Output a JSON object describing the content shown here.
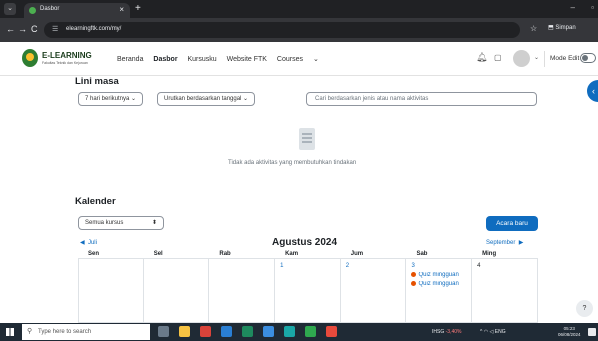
{
  "browser": {
    "tab_title": "Dasbor",
    "url": "elearningftk.com/my/",
    "saved_label": "Simpan",
    "new_tab": "+"
  },
  "navbar": {
    "brand": "E-LEARNING",
    "brand_sub": "Fakultas Teknik dan Kejuruan",
    "menu": {
      "home": "Beranda",
      "dashboard": "Dasbor",
      "my_courses": "Kursusku",
      "site": "Website FTK",
      "courses": "Courses"
    },
    "mode_edit": "Mode Edit"
  },
  "timeline": {
    "title": "Lini masa",
    "filter_days": "7 hari berikutnya",
    "sort": "Urutkan berdasarkan tanggal",
    "search_placeholder": "Cari berdasarkan jenis atau nama aktivitas",
    "empty": "Tidak ada aktivitas yang membutuhkan tindakan"
  },
  "calendar": {
    "title": "Kalender",
    "course_filter": "Semua kursus",
    "new_event": "Acara baru",
    "prev": "Juli",
    "month": "Agustus 2024",
    "next": "September",
    "days": [
      "Sen",
      "Sel",
      "Rab",
      "Kam",
      "Jum",
      "Sab",
      "Ming"
    ],
    "dates": [
      "",
      "",
      "",
      "1",
      "2",
      "3",
      "4"
    ],
    "events": {
      "sat_1": "Quiz mingguan",
      "sat_2": "Quiz mingguan"
    }
  },
  "taskbar": {
    "search": "Type here to search",
    "stock_name": "IHSG",
    "stock_change": "-3,40%",
    "lang": "ENG",
    "time": "05:23",
    "date": "06/08/2024"
  },
  "colors": {
    "accent": "#0f6cbf",
    "event_dot": "#e65100",
    "chrome_dark": "#202124"
  }
}
